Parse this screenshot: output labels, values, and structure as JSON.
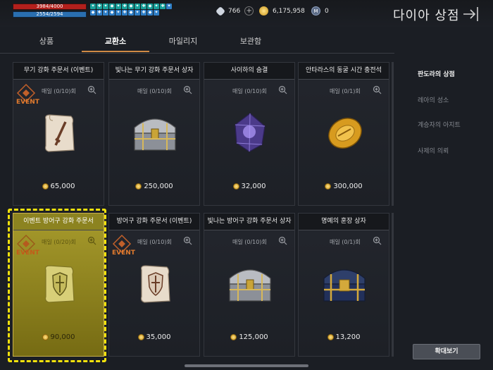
{
  "status": {
    "hp": "3984/4000",
    "hp_fraction": 0.996,
    "mp": "2554/2594",
    "mp_fraction": 0.985
  },
  "currency": [
    {
      "icon": "diamond-icon",
      "value": "766"
    },
    {
      "icon": "gold-coin-icon",
      "value": "6,175,958"
    },
    {
      "icon": "mileage-icon",
      "value": "0"
    }
  ],
  "page_title": "다이아 상점",
  "tabs": [
    {
      "label": "상품",
      "active": false
    },
    {
      "label": "교환소",
      "active": true
    },
    {
      "label": "마일리지",
      "active": false
    },
    {
      "label": "보관함",
      "active": false
    }
  ],
  "items": [
    {
      "name": "무기 강화 주문서 (이벤트)",
      "limit": "매일 (0/10)회",
      "price": "65,000",
      "event": "EVENT",
      "icon": "weapon-scroll-icon"
    },
    {
      "name": "빛나는 무기 강화 주문서 상자",
      "limit": "매일 (0/10)회",
      "price": "250,000",
      "event": "",
      "icon": "silver-chest-icon"
    },
    {
      "name": "사이하의 숨결",
      "limit": "매일 (0/10)회",
      "price": "32,000",
      "event": "",
      "icon": "purple-gem-icon"
    },
    {
      "name": "안타라스의 동굴 시간 충전석",
      "limit": "매일 (0/1)회",
      "price": "300,000",
      "event": "",
      "icon": "gold-stone-icon"
    },
    {
      "name": "이벤트 방어구 강화 주문서",
      "limit": "매일 (0/20)회",
      "price": "90,000",
      "event": "EVENT",
      "icon": "armor-scroll-icon"
    },
    {
      "name": "방어구 강화 주문서 (이벤트)",
      "limit": "매일 (0/10)회",
      "price": "35,000",
      "event": "EVENT",
      "icon": "armor-scroll-icon"
    },
    {
      "name": "빛나는 방어구 강화 주문서 상자",
      "limit": "매일 (0/10)회",
      "price": "125,000",
      "event": "",
      "icon": "silver-chest-icon"
    },
    {
      "name": "명예의 훈장 상자",
      "limit": "매일 (0/1)회",
      "price": "13,200",
      "event": "",
      "icon": "blue-chest-icon"
    }
  ],
  "sidebar": [
    {
      "label": "판도라의 상점",
      "active": true
    },
    {
      "label": "레아의 성소",
      "active": false
    },
    {
      "label": "계승자의 아지트",
      "active": false
    },
    {
      "label": "사제의 의뢰",
      "active": false
    }
  ],
  "zoom_button": "확대보기",
  "colors": {
    "accent": "#d08a45",
    "highlight": "#f2e20c",
    "hp": "#b3201c",
    "mp": "#2a6fb0"
  }
}
